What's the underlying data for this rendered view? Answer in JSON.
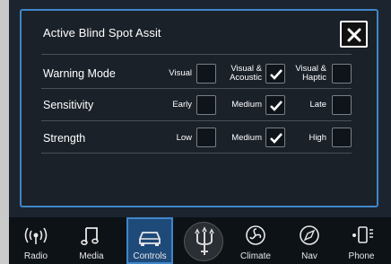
{
  "panel": {
    "title": "Active Blind Spot Assit",
    "close_glyph": "✕"
  },
  "rows": [
    {
      "label": "Warning Mode",
      "options": [
        {
          "label": "Visual",
          "checked": false
        },
        {
          "label": "Visual & Acoustic",
          "checked": true
        },
        {
          "label": "Visual & Haptic",
          "checked": false
        }
      ]
    },
    {
      "label": "Sensitivity",
      "options": [
        {
          "label": "Early",
          "checked": false
        },
        {
          "label": "Medium",
          "checked": true
        },
        {
          "label": "Late",
          "checked": false
        }
      ]
    },
    {
      "label": "Strength",
      "options": [
        {
          "label": "Low",
          "checked": false
        },
        {
          "label": "Medium",
          "checked": true
        },
        {
          "label": "High",
          "checked": false
        }
      ]
    }
  ],
  "nav": {
    "items": [
      {
        "label": "Radio",
        "icon": "radio-icon",
        "active": false
      },
      {
        "label": "Media",
        "icon": "music-note-icon",
        "active": false
      },
      {
        "label": "Controls",
        "icon": "car-icon",
        "active": true
      },
      {
        "label": "",
        "icon": "trident-logo-icon",
        "active": false
      },
      {
        "label": "Climate",
        "icon": "climate-fan-icon",
        "active": false
      },
      {
        "label": "Nav",
        "icon": "compass-icon",
        "active": false
      },
      {
        "label": "Phone",
        "icon": "phone-icon",
        "active": false
      }
    ]
  },
  "colors": {
    "accent": "#3f86c8",
    "background": "#1c2430",
    "text": "#ffffff"
  }
}
